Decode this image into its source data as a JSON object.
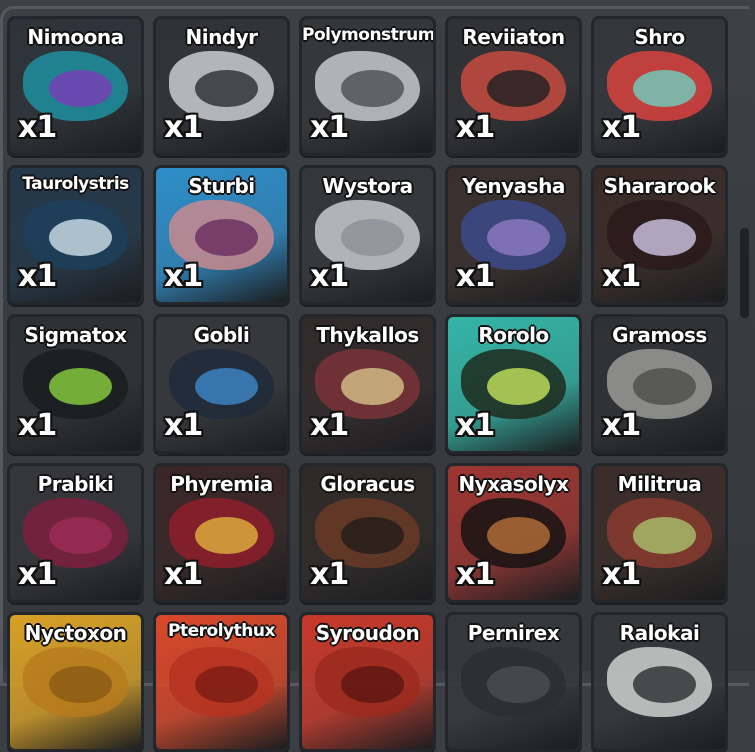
{
  "inventory": {
    "items": [
      {
        "name": "Nimoona",
        "count": "x1",
        "bg": "#2d333a",
        "c2": "#1f8fa0",
        "c3": "#7a3bb5"
      },
      {
        "name": "Nindyr",
        "count": "x1",
        "bg": "#2f3236",
        "c2": "#c9cdd2",
        "c3": "#2b2e31"
      },
      {
        "name": "Polymonstrum",
        "count": "x1",
        "bg": "#343739",
        "c2": "#c4c8cc",
        "c3": "#4a4f55"
      },
      {
        "name": "Reviiaton",
        "count": "x1",
        "bg": "#2f3135",
        "c2": "#c74b3f",
        "c3": "#1d1f23"
      },
      {
        "name": "Shro",
        "count": "x1",
        "bg": "#33363a",
        "c2": "#d9423f",
        "c3": "#6ecfc0"
      },
      {
        "name": "Taurolystris",
        "count": "x1",
        "bg": "#23384a",
        "c2": "#1d3f5c",
        "c3": "#cfe2ea"
      },
      {
        "name": "Sturbi",
        "count": "x1",
        "bg": "#2e8ec9",
        "c2": "#c98a8f",
        "c3": "#6a2a5e"
      },
      {
        "name": "Wystora",
        "count": "x1",
        "bg": "#34373b",
        "c2": "#c7c9cd",
        "c3": "#8e8f96"
      },
      {
        "name": "Yenyasha",
        "count": "x1",
        "bg": "#3a2f2c",
        "c2": "#3b4a8a",
        "c3": "#8e7bc2"
      },
      {
        "name": "Shararook",
        "count": "x1",
        "bg": "#3a2a26",
        "c2": "#2a1a1a",
        "c3": "#d3c7e7"
      },
      {
        "name": "Sigmatox",
        "count": "x1",
        "bg": "#2e3133",
        "c2": "#1a1d1e",
        "c3": "#8bd13f"
      },
      {
        "name": "Gobli",
        "count": "x1",
        "bg": "#35383c",
        "c2": "#1e2a3a",
        "c3": "#3f88c9"
      },
      {
        "name": "Thykallos",
        "count": "x1",
        "bg": "#32292a",
        "c2": "#7a3237",
        "c3": "#d7c38a"
      },
      {
        "name": "Rorolo",
        "count": "x1",
        "bg": "#33b5a6",
        "c2": "#1e2a1c",
        "c3": "#c6e35b"
      },
      {
        "name": "Gramoss",
        "count": "x1",
        "bg": "#2f3134",
        "c2": "#9a9b98",
        "c3": "#4c4d4b"
      },
      {
        "name": "Prabiki",
        "count": "x1",
        "bg": "#34363a",
        "c2": "#7c1f3d",
        "c3": "#9e2d55"
      },
      {
        "name": "Phyremia",
        "count": "x1",
        "bg": "#3a2626",
        "c2": "#8e1d2a",
        "c3": "#e0b13e"
      },
      {
        "name": "Gloracus",
        "count": "x1",
        "bg": "#2f2a27",
        "c2": "#6a3a26",
        "c3": "#1f1b19"
      },
      {
        "name": "Nyxasolyx",
        "count": "x1",
        "bg": "#9c3530",
        "c2": "#161314",
        "c3": "#b5703a"
      },
      {
        "name": "Militrua",
        "count": "x1",
        "bg": "#3a2c28",
        "c2": "#8a3b2e",
        "c3": "#a9c06d"
      },
      {
        "name": "Nyctoxon",
        "count": "",
        "bg": "#d8a126",
        "c2": "#b77b1c",
        "c3": "#8a5a14"
      },
      {
        "name": "Pterolythux",
        "count": "",
        "bg": "#d9482a",
        "c2": "#b53221",
        "c3": "#7a1d14"
      },
      {
        "name": "Syroudon",
        "count": "",
        "bg": "#c7392a",
        "c2": "#9b2a1f",
        "c3": "#5d1712"
      },
      {
        "name": "Pernirex",
        "count": "",
        "bg": "#35383c",
        "c2": "#2b2e31",
        "c3": "#4a4d51"
      },
      {
        "name": "Ralokai",
        "count": "",
        "bg": "#34373b",
        "c2": "#cfd0cf",
        "c3": "#2b2d30"
      }
    ]
  }
}
